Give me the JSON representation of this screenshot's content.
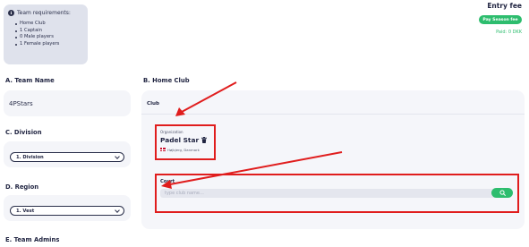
{
  "requirements": {
    "title": "Team requirements:",
    "items": [
      "Home Club",
      "1 Captain",
      "0 Male players",
      "1 Female players"
    ]
  },
  "entry_fee": {
    "title": "Entry fee",
    "pay_button": "Pay Season fee",
    "paid_text": "Paid: 0 DKK"
  },
  "sections": {
    "team_name": "A. Team Name",
    "home_club": "B. Home Club",
    "division": "C. Division",
    "region": "D. Region",
    "team_admins": "E. Team Admins"
  },
  "team_name_value": "4PStars",
  "division_select": {
    "value": "1. Division"
  },
  "region_select": {
    "value": "1. Vest"
  },
  "club": {
    "label": "Club",
    "org_label": "Organization",
    "org_name": "Padel Star",
    "org_location": "Højbjerg, Danmark",
    "court_label": "Court",
    "court_placeholder": "type club name..."
  },
  "colors": {
    "accent_green": "#2dbd6e",
    "highlight_red": "#e01d1d",
    "text_dark": "#1f2340"
  }
}
